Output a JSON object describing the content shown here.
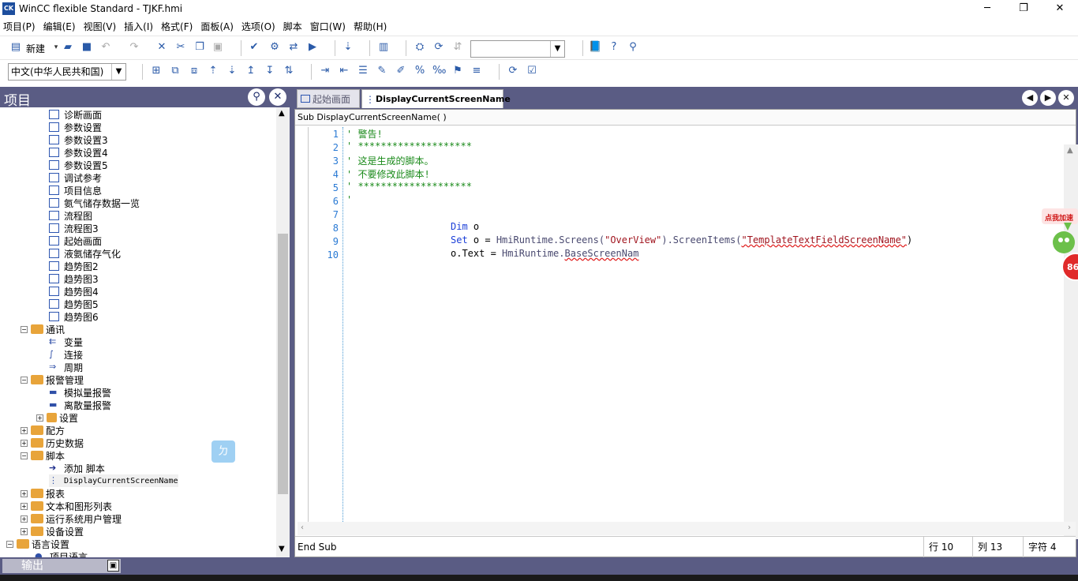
{
  "window": {
    "title": "WinCC flexible Standard - TJKF.hmi",
    "app_icon_text": "CK",
    "minimize": "─",
    "maximize": "❐",
    "close": "✕"
  },
  "menu": [
    "项目(P)",
    "编辑(E)",
    "视图(V)",
    "插入(I)",
    "格式(F)",
    "面板(A)",
    "选项(O)",
    "脚本",
    "窗口(W)",
    "帮助(H)"
  ],
  "toolbar1": {
    "new_label": "新建",
    "combo_value": ""
  },
  "toolbar2": {
    "language_combo": "中文(中华人民共和国)"
  },
  "project_pane": {
    "title": "项目",
    "items": [
      {
        "label": "诊断画面"
      },
      {
        "label": "参数设置"
      },
      {
        "label": "参数设置3"
      },
      {
        "label": "参数设置4"
      },
      {
        "label": "参数设置5"
      },
      {
        "label": "调试参考"
      },
      {
        "label": "项目信息"
      },
      {
        "label": "氨气储存数据一览"
      },
      {
        "label": "流程图"
      },
      {
        "label": "流程图3"
      },
      {
        "label": "起始画面"
      },
      {
        "label": "液氨储存气化"
      },
      {
        "label": "趋势图2"
      },
      {
        "label": "趋势图3"
      },
      {
        "label": "趋势图4"
      },
      {
        "label": "趋势图5"
      },
      {
        "label": "趋势图6"
      },
      {
        "label": "通讯"
      },
      {
        "label": "变量"
      },
      {
        "label": "连接"
      },
      {
        "label": "周期"
      },
      {
        "label": "报警管理"
      },
      {
        "label": "模拟量报警"
      },
      {
        "label": "离散量报警"
      },
      {
        "label": "设置"
      },
      {
        "label": "配方"
      },
      {
        "label": "历史数据"
      },
      {
        "label": "脚本"
      },
      {
        "label": "添加 脚本"
      },
      {
        "label": "DisplayCurrentScreenName"
      },
      {
        "label": "报表"
      },
      {
        "label": "文本和图形列表"
      },
      {
        "label": "运行系统用户管理"
      },
      {
        "label": "设备设置"
      },
      {
        "label": "语言设置"
      },
      {
        "label": "项目语言"
      }
    ]
  },
  "tabs": [
    {
      "label": "起始画面"
    },
    {
      "label": "DisplayCurrentScreenName"
    }
  ],
  "editor": {
    "sub_header": "Sub DisplayCurrentScreenName( )",
    "end_sub": "End Sub",
    "line_numbers": [
      "1",
      "2",
      "3",
      "4",
      "5",
      "6",
      "7",
      "8",
      "9",
      "10"
    ],
    "lines": {
      "l1": "' 警告!",
      "l2": "' ********************",
      "l3": "' 这是生成的脚本。",
      "l4": "' 不要修改此脚本!",
      "l5": "' ********************",
      "l6": "'",
      "l7": "",
      "l8_kw": "Dim",
      "l8_rest": " o",
      "l9_kw": "Set",
      "l9_a": " o = ",
      "l9_b": "HmiRuntime.Screens(",
      "l9_c": "\"OverView\"",
      "l9_d": ").ScreenItems(",
      "l9_e": "\"TemplateTextFieldScreenName\"",
      "l9_f": ")",
      "l10_a": "o.Text = ",
      "l10_b": "HmiRuntime.",
      "l10_c": "BaseScreenNam"
    },
    "status": {
      "row": "行 10",
      "col": "列 13",
      "chars": "字符 4"
    }
  },
  "output_bar": {
    "label": "输出"
  },
  "overlay": {
    "speed_badge": "点我加速",
    "speed_number": "86"
  },
  "ime_indicator": "ㄉ"
}
